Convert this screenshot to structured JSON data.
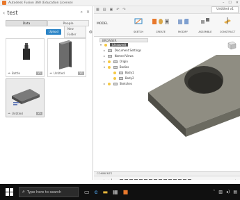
{
  "window": {
    "title": "Autodesk Fusion 360 (Education License)"
  },
  "data_panel": {
    "project": "test",
    "tabs": [
      {
        "label": "Data",
        "active": true
      },
      {
        "label": "People",
        "active": false
      }
    ],
    "upload_label": "Upload",
    "new_folder_label": "New Folder",
    "files": [
      {
        "name": "Bottle",
        "version": "V1",
        "selected": false
      },
      {
        "name": "Untitled",
        "version": "V1",
        "selected": false
      },
      {
        "name": "Untitled",
        "version": "V1",
        "selected": true
      }
    ]
  },
  "main": {
    "document_tab": "Untitled v1",
    "workspace": "MODEL",
    "toolbar_groups": [
      "SKETCH",
      "CREATE",
      "MODIFY",
      "ASSEMBLE",
      "CONSTRUCT"
    ],
    "browser": {
      "header": "BROWSER",
      "items": [
        {
          "label": "(Unsaved)",
          "level": 0,
          "arrow": "▾",
          "root": true
        },
        {
          "label": "Document Settings",
          "level": 1,
          "arrow": "▸"
        },
        {
          "label": "Named Views",
          "level": 1,
          "arrow": "▸"
        },
        {
          "label": "Origin",
          "level": 1,
          "arrow": "▸"
        },
        {
          "label": "Bodies",
          "level": 1,
          "arrow": "▾"
        },
        {
          "label": "Body1",
          "level": 2,
          "arrow": ""
        },
        {
          "label": "Body2",
          "level": 2,
          "arrow": ""
        },
        {
          "label": "Sketches",
          "level": 1,
          "arrow": "▸"
        }
      ]
    },
    "comments_label": "COMMENTS"
  },
  "taskbar": {
    "search_placeholder": "Type here to search"
  },
  "colors": {
    "accent": "#2b84c6",
    "brand": "#e8782c",
    "taskbar": "#101010"
  }
}
